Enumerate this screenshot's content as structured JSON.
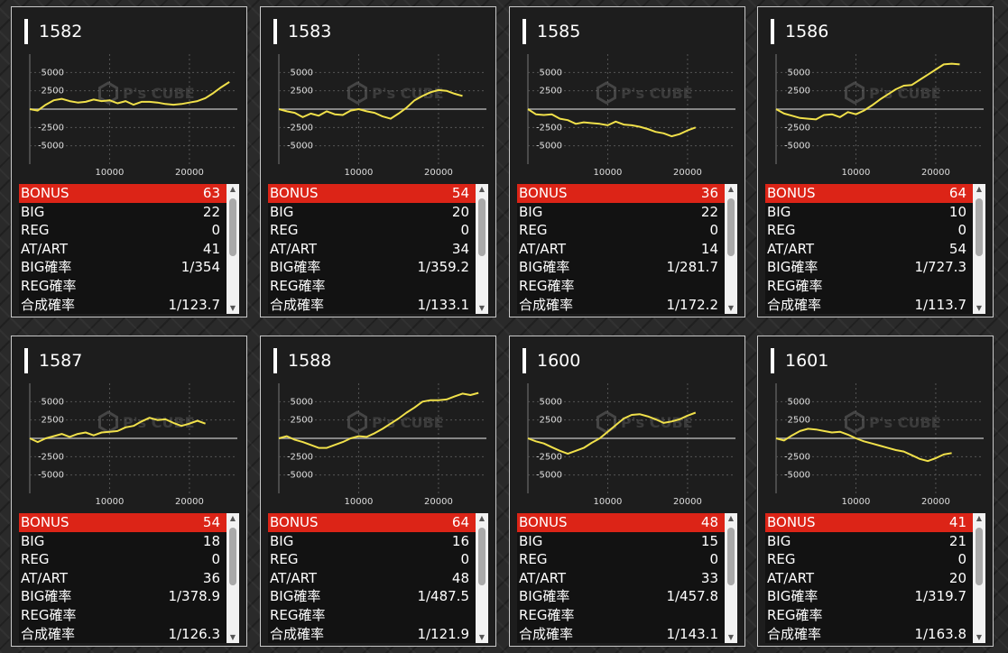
{
  "colors": {
    "line": "#f0e04a",
    "highlight": "#dc2417",
    "card_bg": "#1d1d1d"
  },
  "labels": {
    "bonus": "BONUS",
    "big": "BIG",
    "reg": "REG",
    "at_art": "AT/ART",
    "big_rate": "BIG確率",
    "reg_rate": "REG確率",
    "total_rate": "合成確率"
  },
  "watermark": "P's CUBE",
  "machines": [
    {
      "id": "1582",
      "bonus": "63",
      "big": "22",
      "reg": "0",
      "at_art": "41",
      "big_rate": "1/354",
      "reg_rate": "",
      "total_rate": "1/123.7"
    },
    {
      "id": "1583",
      "bonus": "54",
      "big": "20",
      "reg": "0",
      "at_art": "34",
      "big_rate": "1/359.2",
      "reg_rate": "",
      "total_rate": "1/133.1"
    },
    {
      "id": "1585",
      "bonus": "36",
      "big": "22",
      "reg": "0",
      "at_art": "14",
      "big_rate": "1/281.7",
      "reg_rate": "",
      "total_rate": "1/172.2"
    },
    {
      "id": "1586",
      "bonus": "64",
      "big": "10",
      "reg": "0",
      "at_art": "54",
      "big_rate": "1/727.3",
      "reg_rate": "",
      "total_rate": "1/113.7"
    },
    {
      "id": "1587",
      "bonus": "54",
      "big": "18",
      "reg": "0",
      "at_art": "36",
      "big_rate": "1/378.9",
      "reg_rate": "",
      "total_rate": "1/126.3"
    },
    {
      "id": "1588",
      "bonus": "64",
      "big": "16",
      "reg": "0",
      "at_art": "48",
      "big_rate": "1/487.5",
      "reg_rate": "",
      "total_rate": "1/121.9"
    },
    {
      "id": "1600",
      "bonus": "48",
      "big": "15",
      "reg": "0",
      "at_art": "33",
      "big_rate": "1/457.8",
      "reg_rate": "",
      "total_rate": "1/143.1"
    },
    {
      "id": "1601",
      "bonus": "41",
      "big": "21",
      "reg": "0",
      "at_art": "20",
      "big_rate": "1/319.7",
      "reg_rate": "",
      "total_rate": "1/163.8"
    }
  ],
  "chart_data": [
    {
      "type": "line",
      "title": "1582",
      "xlim": [
        0,
        26000
      ],
      "ylim": [
        -7500,
        7500
      ],
      "xticks": [
        10000,
        20000
      ],
      "yticks": [
        5000,
        2500,
        -2500,
        -5000
      ],
      "series": [
        {
          "x": [
            0,
            1000,
            2000,
            3000,
            4000,
            5000,
            6000,
            7000,
            8000,
            9000,
            10000,
            11000,
            12000,
            13000,
            14000,
            15000,
            16000,
            17000,
            18000,
            19000,
            20000,
            21000,
            22000,
            23000,
            24000,
            25000
          ],
          "y": [
            0,
            -200,
            600,
            1200,
            1400,
            1100,
            900,
            1000,
            1300,
            1100,
            1200,
            800,
            1100,
            600,
            1000,
            1000,
            900,
            700,
            600,
            700,
            900,
            1100,
            1500,
            2200,
            3000,
            3700
          ]
        }
      ]
    },
    {
      "type": "line",
      "title": "1583",
      "xlim": [
        0,
        26000
      ],
      "ylim": [
        -7500,
        7500
      ],
      "xticks": [
        10000,
        20000
      ],
      "yticks": [
        5000,
        2500,
        -2500,
        -5000
      ],
      "series": [
        {
          "x": [
            0,
            1000,
            2000,
            3000,
            4000,
            5000,
            6000,
            7000,
            8000,
            9000,
            10000,
            11000,
            12000,
            13000,
            14000,
            15000,
            16000,
            17000,
            18000,
            19000,
            20000,
            21000,
            22000,
            23000
          ],
          "y": [
            0,
            -300,
            -500,
            -1100,
            -600,
            -900,
            -300,
            -700,
            -800,
            -200,
            0,
            -300,
            -500,
            -1000,
            -1300,
            -600,
            200,
            1200,
            1800,
            2300,
            2600,
            2500,
            2100,
            1800
          ]
        }
      ]
    },
    {
      "type": "line",
      "title": "1585",
      "xlim": [
        0,
        26000
      ],
      "ylim": [
        -7500,
        7500
      ],
      "xticks": [
        10000,
        20000
      ],
      "yticks": [
        5000,
        2500,
        -2500,
        -5000
      ],
      "series": [
        {
          "x": [
            0,
            1000,
            2000,
            3000,
            4000,
            5000,
            6000,
            7000,
            8000,
            9000,
            10000,
            11000,
            12000,
            13000,
            14000,
            15000,
            16000,
            17000,
            18000,
            19000,
            20000,
            21000
          ],
          "y": [
            0,
            -700,
            -800,
            -700,
            -1300,
            -1500,
            -2000,
            -1800,
            -1900,
            -2000,
            -2200,
            -1700,
            -2100,
            -2200,
            -2400,
            -2700,
            -3100,
            -3300,
            -3700,
            -3400,
            -2900,
            -2500
          ]
        }
      ]
    },
    {
      "type": "line",
      "title": "1586",
      "xlim": [
        0,
        26000
      ],
      "ylim": [
        -7500,
        7500
      ],
      "xticks": [
        10000,
        20000
      ],
      "yticks": [
        5000,
        2500,
        -2500,
        -5000
      ],
      "series": [
        {
          "x": [
            0,
            1000,
            2000,
            3000,
            4000,
            5000,
            6000,
            7000,
            8000,
            9000,
            10000,
            11000,
            12000,
            13000,
            14000,
            15000,
            16000,
            17000,
            18000,
            19000,
            20000,
            21000,
            22000,
            23000
          ],
          "y": [
            0,
            -600,
            -900,
            -1200,
            -1300,
            -1400,
            -800,
            -700,
            -1100,
            -400,
            -700,
            -200,
            500,
            1300,
            2000,
            2700,
            3200,
            3300,
            4000,
            4700,
            5400,
            6100,
            6200,
            6100
          ]
        }
      ]
    },
    {
      "type": "line",
      "title": "1587",
      "xlim": [
        0,
        26000
      ],
      "ylim": [
        -7500,
        7500
      ],
      "xticks": [
        10000,
        20000
      ],
      "yticks": [
        5000,
        2500,
        -2500,
        -5000
      ],
      "series": [
        {
          "x": [
            0,
            1000,
            2000,
            3000,
            4000,
            5000,
            6000,
            7000,
            8000,
            9000,
            10000,
            11000,
            12000,
            13000,
            14000,
            15000,
            16000,
            17000,
            18000,
            19000,
            20000,
            21000,
            22000
          ],
          "y": [
            0,
            -500,
            0,
            300,
            600,
            200,
            600,
            800,
            400,
            800,
            900,
            1000,
            1500,
            1700,
            2300,
            2800,
            2500,
            2600,
            2100,
            1700,
            2000,
            2400,
            2000
          ]
        }
      ]
    },
    {
      "type": "line",
      "title": "1588",
      "xlim": [
        0,
        26000
      ],
      "ylim": [
        -7500,
        7500
      ],
      "xticks": [
        10000,
        20000
      ],
      "yticks": [
        5000,
        2500,
        -2500,
        -5000
      ],
      "series": [
        {
          "x": [
            0,
            1000,
            2000,
            3000,
            4000,
            5000,
            6000,
            7000,
            8000,
            9000,
            10000,
            11000,
            12000,
            13000,
            14000,
            15000,
            16000,
            17000,
            18000,
            19000,
            20000,
            21000,
            22000,
            23000,
            24000,
            25000
          ],
          "y": [
            0,
            300,
            -200,
            -500,
            -900,
            -1300,
            -1300,
            -900,
            -500,
            0,
            300,
            200,
            700,
            1300,
            2000,
            2700,
            3500,
            4200,
            5000,
            5200,
            5200,
            5300,
            5700,
            6100,
            5900,
            6200
          ]
        }
      ]
    },
    {
      "type": "line",
      "title": "1600",
      "xlim": [
        0,
        26000
      ],
      "ylim": [
        -7500,
        7500
      ],
      "xticks": [
        10000,
        20000
      ],
      "yticks": [
        5000,
        2500,
        -2500,
        -5000
      ],
      "series": [
        {
          "x": [
            0,
            1000,
            2000,
            3000,
            4000,
            5000,
            6000,
            7000,
            8000,
            9000,
            10000,
            11000,
            12000,
            13000,
            14000,
            15000,
            16000,
            17000,
            18000,
            19000,
            20000,
            21000
          ],
          "y": [
            0,
            -400,
            -700,
            -1200,
            -1700,
            -2100,
            -1700,
            -1300,
            -600,
            0,
            900,
            1800,
            2700,
            3200,
            3300,
            3000,
            2600,
            2100,
            2300,
            2600,
            3100,
            3500
          ]
        }
      ]
    },
    {
      "type": "line",
      "title": "1601",
      "xlim": [
        0,
        26000
      ],
      "ylim": [
        -7500,
        7500
      ],
      "xticks": [
        10000,
        20000
      ],
      "yticks": [
        5000,
        2500,
        -2500,
        -5000
      ],
      "series": [
        {
          "x": [
            0,
            1000,
            2000,
            3000,
            4000,
            5000,
            6000,
            7000,
            8000,
            9000,
            10000,
            11000,
            12000,
            13000,
            14000,
            15000,
            16000,
            17000,
            18000,
            19000,
            20000,
            21000,
            22000
          ],
          "y": [
            0,
            -300,
            400,
            1000,
            1300,
            1200,
            1000,
            800,
            900,
            500,
            0,
            -400,
            -700,
            -1000,
            -1300,
            -1600,
            -1800,
            -2300,
            -2800,
            -3100,
            -2700,
            -2200,
            -2000
          ]
        }
      ]
    }
  ]
}
